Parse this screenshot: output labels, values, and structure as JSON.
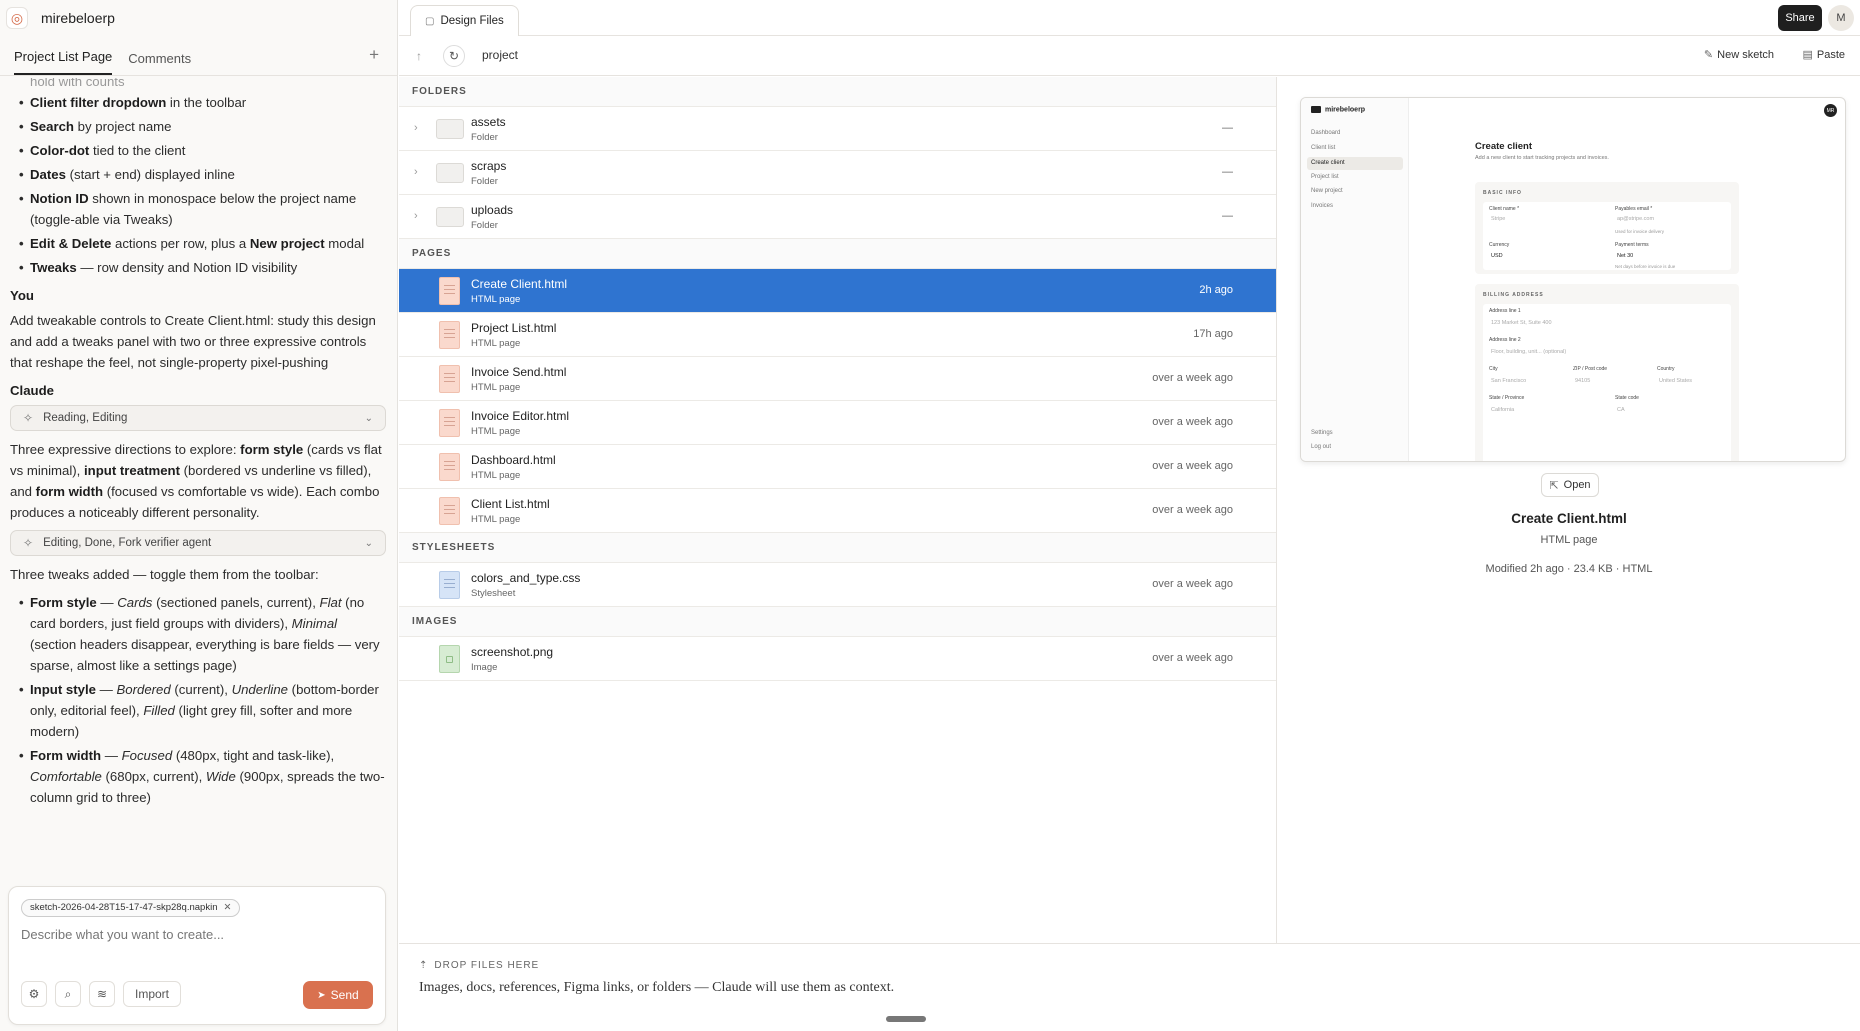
{
  "app": {
    "project_name": "mirebeloerp",
    "left_tabs": [
      "Project List Page",
      "Comments"
    ],
    "add_tab": "+"
  },
  "chat": {
    "faded_line": "hold with counts",
    "features": [
      {
        "bold": "Client filter dropdown",
        "rest": " in the toolbar"
      },
      {
        "bold": "Search",
        "rest": " by project name"
      },
      {
        "bold": "Color-dot",
        "rest": " tied to the client"
      },
      {
        "bold": "Dates",
        "rest": " (start + end) displayed inline"
      },
      {
        "bold": "Notion ID",
        "rest": " shown in monospace below the project name (toggle-able via Tweaks)"
      },
      {
        "bold": "Edit & Delete",
        "rest": " actions per row, plus a ",
        "bold2": "New project",
        "rest2": " modal"
      },
      {
        "bold": "Tweaks",
        "rest": " — row density and Notion ID visibility"
      }
    ],
    "you_label": "You",
    "you_message": "Add tweakable controls to Create Client.html: study this design and add a tweaks panel with two or three expressive controls that reshape the feel, not single-property pixel-pushing",
    "claude_label": "Claude",
    "tool_pill_1": "Reading, Editing",
    "reply_1": {
      "a": "Three expressive directions to explore: ",
      "b1": "form style",
      "c1": " (cards vs flat vs minimal), ",
      "b2": "input treatment",
      "c2": " (bordered vs underline vs filled), and ",
      "b3": "form width",
      "c3": " (focused vs comfortable vs wide). Each combo produces a noticeably different personality."
    },
    "tool_pill_2": "Editing, Done, Fork verifier agent",
    "reply_2_intro": "Three tweaks added — toggle them from the toolbar:",
    "tweaks": [
      {
        "bold": "Form style",
        "dash": " — ",
        "i1": "Cards",
        "t1": " (sectioned panels, current), ",
        "i2": "Flat",
        "t2": " (no card borders, just field groups with dividers), ",
        "i3": "Minimal",
        "t3": " (section headers disappear, everything is bare fields — very sparse, almost like a settings page)"
      },
      {
        "bold": "Input style",
        "dash": " — ",
        "i1": "Bordered",
        "t1": " (current), ",
        "i2": "Underline",
        "t2": " (bottom-border only, editorial feel), ",
        "i3": "Filled",
        "t3": " (light grey fill, softer and more modern)"
      },
      {
        "bold": "Form width",
        "dash": " — ",
        "i1": "Focused",
        "t1": " (480px, tight and task-like), ",
        "i2": "Comfortable",
        "t2": " (680px, current), ",
        "i3": "Wide",
        "t3": " (900px, spreads the two-column grid to three)"
      }
    ]
  },
  "composer": {
    "attachment": "sketch-2026-04-28T15-17-47-skp28q.napkin",
    "placeholder": "Describe what you want to create...",
    "import_label": "Import",
    "send_label": "Send"
  },
  "topbar": {
    "tab_label": "Design Files",
    "share_label": "Share",
    "avatar_initial": "M"
  },
  "pathbar": {
    "path": "project",
    "new_sketch": "New sketch",
    "paste": "Paste"
  },
  "sections": {
    "folders": "FOLDERS",
    "pages": "PAGES",
    "stylesheets": "STYLESHEETS",
    "images": "IMAGES"
  },
  "folders": [
    {
      "name": "assets",
      "kind": "Folder",
      "modified": "—"
    },
    {
      "name": "scraps",
      "kind": "Folder",
      "modified": "—"
    },
    {
      "name": "uploads",
      "kind": "Folder",
      "modified": "—"
    }
  ],
  "pages": [
    {
      "name": "Create Client.html",
      "kind": "HTML page",
      "modified": "2h ago",
      "selected": true
    },
    {
      "name": "Project List.html",
      "kind": "HTML page",
      "modified": "17h ago"
    },
    {
      "name": "Invoice Send.html",
      "kind": "HTML page",
      "modified": "over a week ago"
    },
    {
      "name": "Invoice Editor.html",
      "kind": "HTML page",
      "modified": "over a week ago"
    },
    {
      "name": "Dashboard.html",
      "kind": "HTML page",
      "modified": "over a week ago"
    },
    {
      "name": "Client List.html",
      "kind": "HTML page",
      "modified": "over a week ago"
    }
  ],
  "stylesheets": [
    {
      "name": "colors_and_type.css",
      "kind": "Stylesheet",
      "modified": "over a week ago"
    }
  ],
  "images": [
    {
      "name": "screenshot.png",
      "kind": "Image",
      "modified": "over a week ago"
    }
  ],
  "preview": {
    "open_label": "Open",
    "name": "Create Client.html",
    "kind": "HTML page",
    "meta": "Modified 2h ago · 23.4 KB · HTML",
    "mock": {
      "brand": "mirebeloerp",
      "avatar": "MR",
      "nav": [
        "Dashboard",
        "Client list",
        "Create client",
        "Project list",
        "New project",
        "Invoices"
      ],
      "nav_bottom": [
        "Settings",
        "Log out"
      ],
      "title": "Create client",
      "subtitle": "Add a new client to start tracking projects and invoices.",
      "basic_info": "BASIC INFO",
      "client_name_label": "Client name *",
      "client_name_val": "Stripe",
      "payables_label": "Payables email *",
      "payables_val": "ap@stripe.com",
      "payables_hint": "Used for invoice delivery",
      "currency_label": "Currency",
      "currency_val": "USD",
      "terms_label": "Payment terms",
      "terms_val": "Net 30",
      "terms_hint": "Net days before invoice is due",
      "billing": "BILLING ADDRESS",
      "addr1_label": "Address line 1",
      "addr1_val": "123 Market St, Suite 400",
      "addr2_label": "Address line 2",
      "addr2_val": "Floor, building, unit... (optional)",
      "city_label": "City",
      "city_val": "San Francisco",
      "zip_label": "ZIP / Post code",
      "zip_val": "94105",
      "country_label": "Country",
      "country_val": "United States",
      "state_label": "State / Province",
      "state_val": "California",
      "state2_label": "State code",
      "state2_val": "CA"
    }
  },
  "dropzone": {
    "label": "DROP FILES HERE",
    "text": "Images, docs, references, Figma links, or folders — Claude will use them as context."
  }
}
